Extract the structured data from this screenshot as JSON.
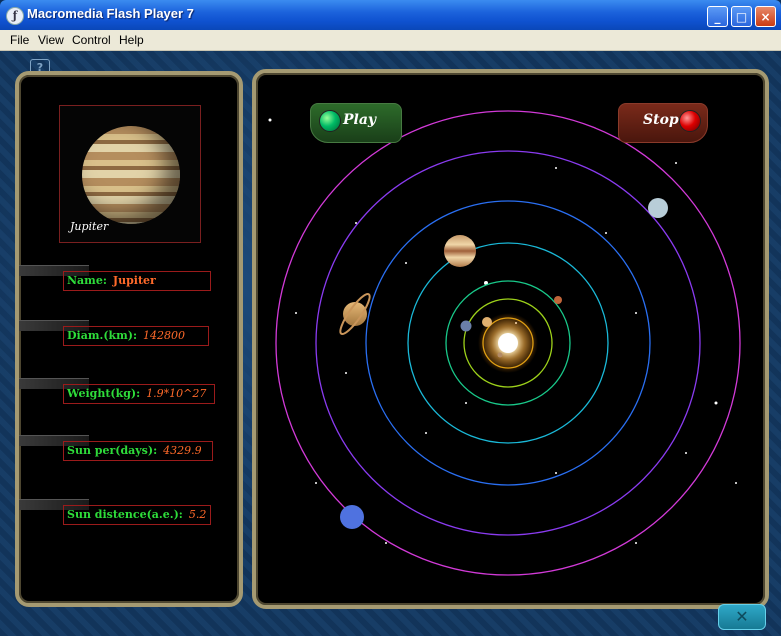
{
  "window": {
    "title": "Macromedia Flash Player 7",
    "controls": {
      "minimize": "_",
      "maximize": "□",
      "close": "×"
    }
  },
  "menu": [
    "File",
    "View",
    "Control",
    "Help"
  ],
  "planet_preview": {
    "caption": "Jupiter",
    "icon": "jupiter-planet-image"
  },
  "info": {
    "name_label": "Name:",
    "name_value": "Jupiter",
    "diam_label": "Diam.(km):",
    "diam_value": "142800",
    "weight_label": "Weight(kg):",
    "weight_value": "1.9*10^27",
    "period_label": "Sun per(days):",
    "period_value": "4329.9",
    "distance_label": "Sun distence(a.e.):",
    "distance_value": "5.2"
  },
  "controls": {
    "play_label": "Play",
    "stop_label": "Stop"
  },
  "exit_icon": "x-icon",
  "colors": {
    "label_green": "#2edc3a",
    "value_orange": "#ff6a2a",
    "frame_red": "#9b1b1b",
    "panel_gold": "#a59a72"
  }
}
